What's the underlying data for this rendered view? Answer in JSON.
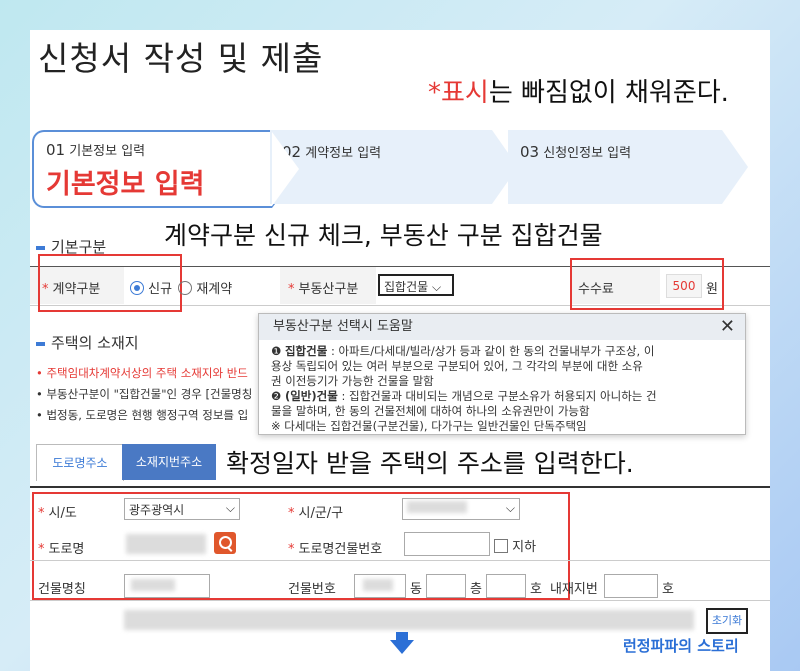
{
  "title": "신청서 작성 및 제출",
  "note": {
    "star": "*",
    "red": "표시",
    "rest": "는 빠짐없이 채워준다."
  },
  "steps": [
    {
      "num": "01",
      "label": "기본정보 입력",
      "big": "기본정보 입력"
    },
    {
      "num": "02",
      "label": "계약정보 입력"
    },
    {
      "num": "03",
      "label": "신청인정보 입력"
    }
  ],
  "annot1": "계약구분 신규 체크, 부동산 구분 집합건물",
  "annot2": "확정일자 받을 주택의 주소를 입력한다.",
  "basic": {
    "section": "기본구분",
    "contract_label": "계약구분",
    "opt_new": "신규",
    "opt_renew": "재계약",
    "realty_label": "부동산구분",
    "realty_value": "집합건물",
    "fee_label": "수수료",
    "fee_value": "500",
    "fee_unit": "원"
  },
  "location": {
    "section": "주택의 소재지",
    "bullets": [
      "주택임대차계약서상의 주택 소재지와 반드",
      "부동산구분이 \"집합건물\"인 경우 [건물명칭",
      "법정동, 도로명은 현행 행정구역 정보를 입"
    ]
  },
  "popup": {
    "title": "부동산구분 선택시 도움말",
    "close": "✕",
    "item1_num": "❶",
    "item1_head": "집합건물",
    "item1_text1": " : 아파트/다세대/빌라/상가 등과 같이 한 동의 건물내부가 구조상, 이",
    "item1_text2": "용상 독립되어 있는 여러 부분으로 구분되어 있어, 그 각각의 부분에 대한 소유",
    "item1_text3": "권 이전등기가 가능한 건물을 말함",
    "item2_num": "❷",
    "item2_head": "(일반)건물",
    "item2_text1": " : 집합건물과 대비되는 개념으로 구분소유가 허용되지 아니하는 건",
    "item2_text2": "물을 말하며, 한 동의 건물전체에 대하여 하나의 소유권만이 가능함",
    "item2_text3": "※ 다세대는 집합건물(구분건물), 다가구는 일반건물인 단독주택임"
  },
  "tabs": [
    "도로명주소",
    "소재지번주소"
  ],
  "address": {
    "sido_label": "시/도",
    "sido_value": "광주광역시",
    "sigungu_label": "시/군/구",
    "road_label": "도로명",
    "road_no_label": "도로명건물번호",
    "underground": "지하",
    "bldg_name_label": "건물명칭",
    "bldg_no_label": "건물번호",
    "dong": "동",
    "floor": "층",
    "ho": "호",
    "inner_label": "내재지번",
    "ho2": "호",
    "reset": "초기화"
  },
  "footer": "런정파파의 스토리",
  "colors": {
    "accent": "#e53935",
    "blue": "#3d7bd6"
  }
}
